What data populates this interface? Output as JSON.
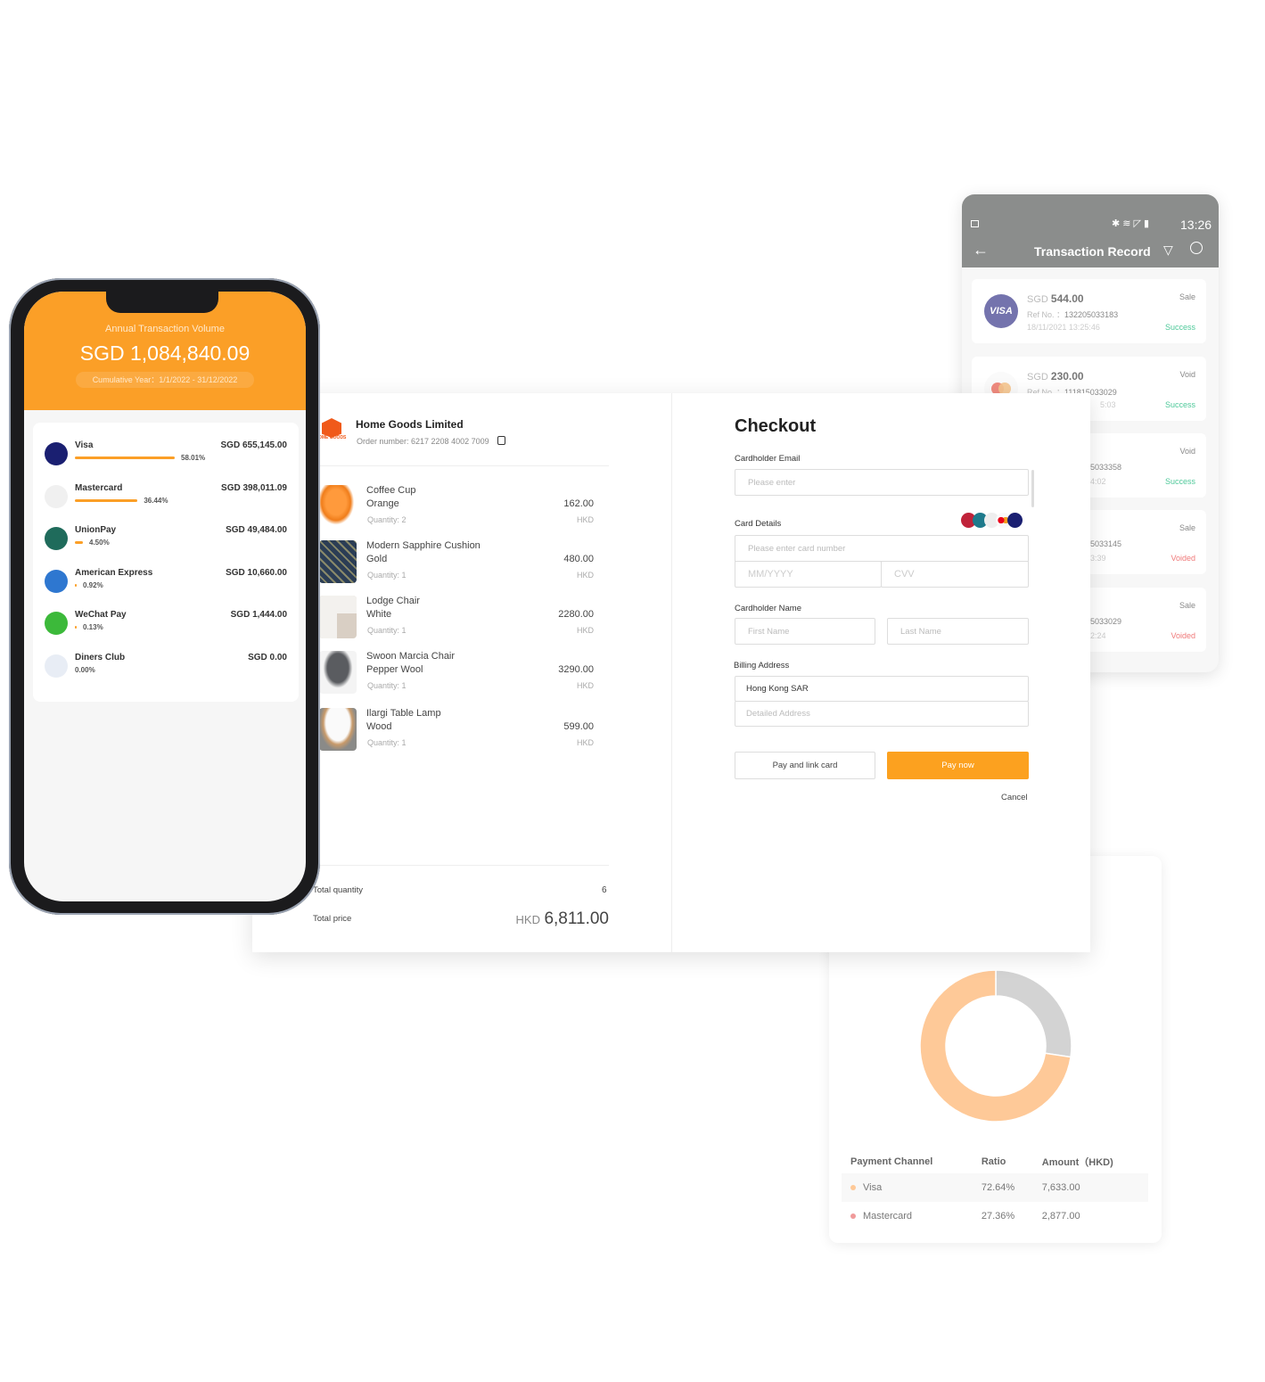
{
  "transaction_record": {
    "status_time": "13:26",
    "title": "Transaction Record",
    "cards": [
      {
        "currency": "SGD",
        "amount": "544.00",
        "ref_label": "Ref No. ：",
        "ref": "132205033183",
        "datetime": "18/11/2021 13:25:46",
        "type": "Sale",
        "status": "Success",
        "brand": "VISA"
      },
      {
        "currency": "SGD",
        "amount": "230.00",
        "ref_label": "Ref No. ：",
        "ref": "111815033029",
        "datetime_fragment": "5:03",
        "type": "Void",
        "status": "Success"
      },
      {
        "ref_fragment": "5033358",
        "datetime_fragment": "4:02",
        "type": "Void",
        "status": "Success"
      },
      {
        "ref_fragment": "5033145",
        "datetime_fragment": "3:39",
        "type": "Sale",
        "status": "Voided"
      },
      {
        "ref_fragment": "5033029",
        "datetime_fragment": "2:24",
        "type": "Sale",
        "status": "Voided"
      }
    ],
    "colors": {
      "success": "#4fc99a",
      "voided": "#f07a7a",
      "header": "#8b8d8c"
    }
  },
  "chart_data": {
    "type": "pie",
    "donut": true,
    "slices": [
      {
        "label": "Visa",
        "value": 72.64,
        "color": "#fec998"
      },
      {
        "label": "Mastercard",
        "value": 27.36,
        "color": "#d3d3d3"
      }
    ]
  },
  "channel_table": {
    "headers": [
      "Payment Channel",
      "Ratio",
      "Amount（HKD)"
    ],
    "rows": [
      {
        "channel": "Visa",
        "ratio": "72.64%",
        "amount": "7,633.00",
        "dot": "#fec998"
      },
      {
        "channel": "Mastercard",
        "ratio": "27.36%",
        "amount": "2,877.00",
        "dot": "#f09a9a"
      }
    ]
  },
  "order": {
    "merchant": "Home Goods Limited",
    "logo_text": "OME GOODS",
    "order_number": "Order number: 6217 2208 4002 7009",
    "items": [
      {
        "name": "Coffee Cup",
        "variant": "Orange",
        "quantity": "Quantity: 2",
        "price": "162.00",
        "currency": "HKD"
      },
      {
        "name": "Modern Sapphire Cushion",
        "variant": "Gold",
        "quantity": "Quantity: 1",
        "price": "480.00",
        "currency": "HKD"
      },
      {
        "name": "Lodge Chair",
        "variant": "White",
        "quantity": "Quantity: 1",
        "price": "2280.00",
        "currency": "HKD"
      },
      {
        "name": "Swoon Marcia Chair",
        "variant": "Pepper Wool",
        "quantity": "Quantity: 1",
        "price": "3290.00",
        "currency": "HKD"
      },
      {
        "name": "Ilargi Table Lamp",
        "variant": "Wood",
        "quantity": "Quantity: 1",
        "price": "599.00",
        "currency": "HKD"
      }
    ],
    "total_quantity_label": "Total quantity",
    "total_quantity": "6",
    "total_price_label": "Total price",
    "total_currency": "HKD",
    "total_price": "6,811.00"
  },
  "checkout": {
    "title": "Checkout",
    "email_label": "Cardholder Email",
    "email_placeholder": "Please enter",
    "card_label": "Card Details",
    "card_placeholder": "Please enter card number",
    "expiry_placeholder": "MM/YYYY",
    "cvv_placeholder": "CVV",
    "name_label": "Cardholder Name",
    "first_placeholder": "First Name",
    "last_placeholder": "Last Name",
    "billing_label": "Billing Address",
    "region_value": "Hong Kong SAR",
    "address_placeholder": "Detailed Address",
    "pay_link_label": "Pay and link card",
    "pay_now_label": "Pay now",
    "cancel_label": "Cancel",
    "accent": "#fca11f"
  },
  "phone": {
    "title": "Annual Transaction Volume",
    "total": "SGD 1,084,840.09",
    "period": "Cumulative Year：1/1/2022 - 31/12/2022",
    "methods": [
      {
        "name": "Visa",
        "amount": "SGD 655,145.00",
        "percent": "58.01%",
        "share": 58.01,
        "color": "#1a1f71",
        "icon": "VISA"
      },
      {
        "name": "Mastercard",
        "amount": "SGD 398,011.09",
        "percent": "36.44%",
        "share": 36.44,
        "color": "#f0f0f0"
      },
      {
        "name": "UnionPay",
        "amount": "SGD 49,484.00",
        "percent": "4.50%",
        "share": 4.5,
        "color": "#1f6b5b"
      },
      {
        "name": "American Express",
        "amount": "SGD 10,660.00",
        "percent": "0.92%",
        "share": 0.92,
        "color": "#2e77d0"
      },
      {
        "name": "WeChat Pay",
        "amount": "SGD 1,444.00",
        "percent": "0.13%",
        "share": 0.13,
        "color": "#3cb93a"
      },
      {
        "name": "Diners Club",
        "amount": "SGD 0.00",
        "percent": "0.00%",
        "share": 0,
        "color": "#e8edf5"
      }
    ]
  }
}
